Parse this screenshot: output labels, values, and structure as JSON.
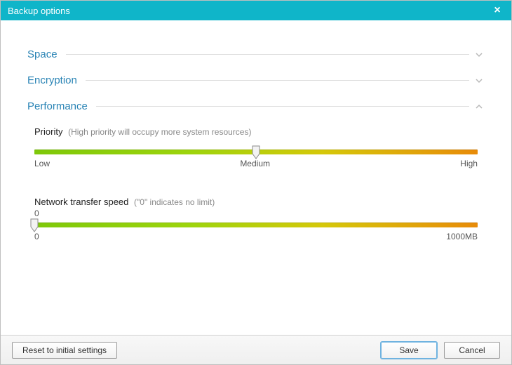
{
  "window": {
    "title": "Backup options",
    "close_symbol": "×"
  },
  "sections": {
    "space": {
      "title": "Space",
      "expanded": false
    },
    "encryption": {
      "title": "Encryption",
      "expanded": false
    },
    "performance": {
      "title": "Performance",
      "expanded": true
    }
  },
  "performance": {
    "priority": {
      "label": "Priority",
      "hint": "(High priority will occupy more system resources)",
      "scale": {
        "low": "Low",
        "medium": "Medium",
        "high": "High"
      },
      "value_fraction": 0.5
    },
    "transfer": {
      "label": "Network transfer speed",
      "hint": "(\"0\" indicates no limit)",
      "current_value": "0",
      "scale": {
        "min": "0",
        "max": "1000MB"
      },
      "value_fraction": 0.0
    }
  },
  "footer": {
    "reset": "Reset to initial settings",
    "save": "Save",
    "cancel": "Cancel"
  }
}
